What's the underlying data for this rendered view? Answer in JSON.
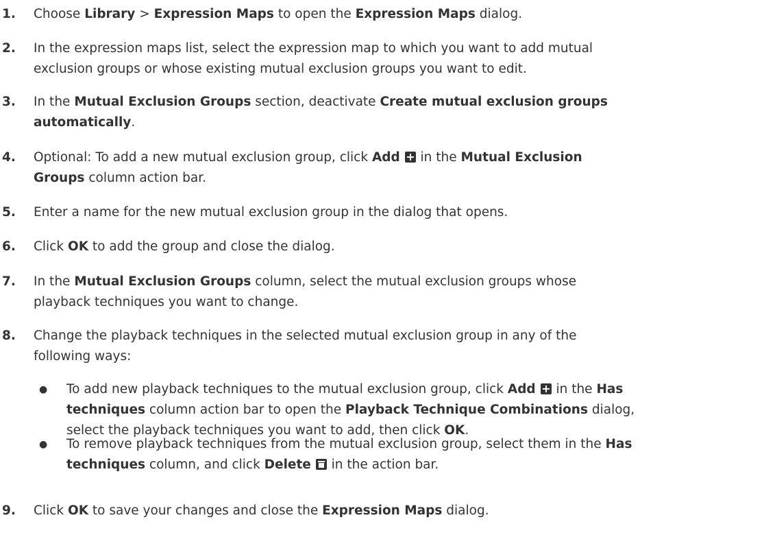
{
  "steps": [
    {
      "num": "1.",
      "lines": [
        [
          "Choose ",
          {
            "b": "Library"
          },
          " > ",
          {
            "b": "Expression Maps"
          },
          " to open the ",
          {
            "b": "Expression Maps"
          },
          " dialog."
        ]
      ]
    },
    {
      "num": "2.",
      "lines": [
        [
          "In the expression maps list, select the expression map to which you want to add mutual"
        ],
        [
          "exclusion groups or whose existing mutual exclusion groups you want to edit."
        ]
      ]
    },
    {
      "num": "3.",
      "lines": [
        [
          "In the ",
          {
            "b": "Mutual Exclusion Groups"
          },
          " section, deactivate ",
          {
            "b": "Create mutual exclusion groups"
          }
        ],
        [
          {
            "b": "automatically"
          },
          "."
        ]
      ]
    },
    {
      "num": "4.",
      "lines": [
        [
          "Optional: To add a new mutual exclusion group, click ",
          {
            "b": "Add"
          },
          " ",
          {
            "icon": "plus"
          },
          " in the ",
          {
            "b": "Mutual Exclusion"
          }
        ],
        [
          {
            "b": "Groups"
          },
          " column action bar."
        ]
      ]
    },
    {
      "num": "5.",
      "lines": [
        [
          "Enter a name for the new mutual exclusion group in the dialog that opens."
        ]
      ]
    },
    {
      "num": "6.",
      "lines": [
        [
          "Click ",
          {
            "b": "OK"
          },
          " to add the group and close the dialog."
        ]
      ]
    },
    {
      "num": "7.",
      "lines": [
        [
          "In the ",
          {
            "b": "Mutual Exclusion Groups"
          },
          " column, select the mutual exclusion groups whose"
        ],
        [
          "playback techniques you want to change."
        ]
      ]
    },
    {
      "num": "8.",
      "lines": [
        [
          "Change the playback techniques in the selected mutual exclusion group in any of the"
        ],
        [
          "following ways:"
        ]
      ]
    },
    {
      "num": "9.",
      "lines": [
        [
          "Click ",
          {
            "b": "OK"
          },
          " to save your changes and close the ",
          {
            "b": "Expression Maps"
          },
          " dialog."
        ]
      ]
    }
  ],
  "substeps": [
    {
      "bullet": "●",
      "lines": [
        [
          "To add new playback techniques to the mutual exclusion group, click ",
          {
            "b": "Add"
          },
          " ",
          {
            "icon": "plus"
          },
          " in the ",
          {
            "b": "Has"
          }
        ],
        [
          {
            "b": "techniques"
          },
          " column action bar to open the ",
          {
            "b": "Playback Technique Combinations"
          },
          " dialog,"
        ],
        [
          "select the playback techniques you want to add, then click ",
          {
            "b": "OK"
          },
          "."
        ]
      ]
    },
    {
      "bullet": "●",
      "lines": [
        [
          "To remove playback techniques from the mutual exclusion group, select them in the ",
          {
            "b": "Has"
          }
        ],
        [
          {
            "b": "techniques"
          },
          " column, and click ",
          {
            "b": "Delete"
          },
          " ",
          {
            "icon": "trash"
          },
          " in the action bar."
        ]
      ]
    }
  ],
  "icons": {
    "plus": "plus-icon",
    "trash": "trash-icon"
  }
}
